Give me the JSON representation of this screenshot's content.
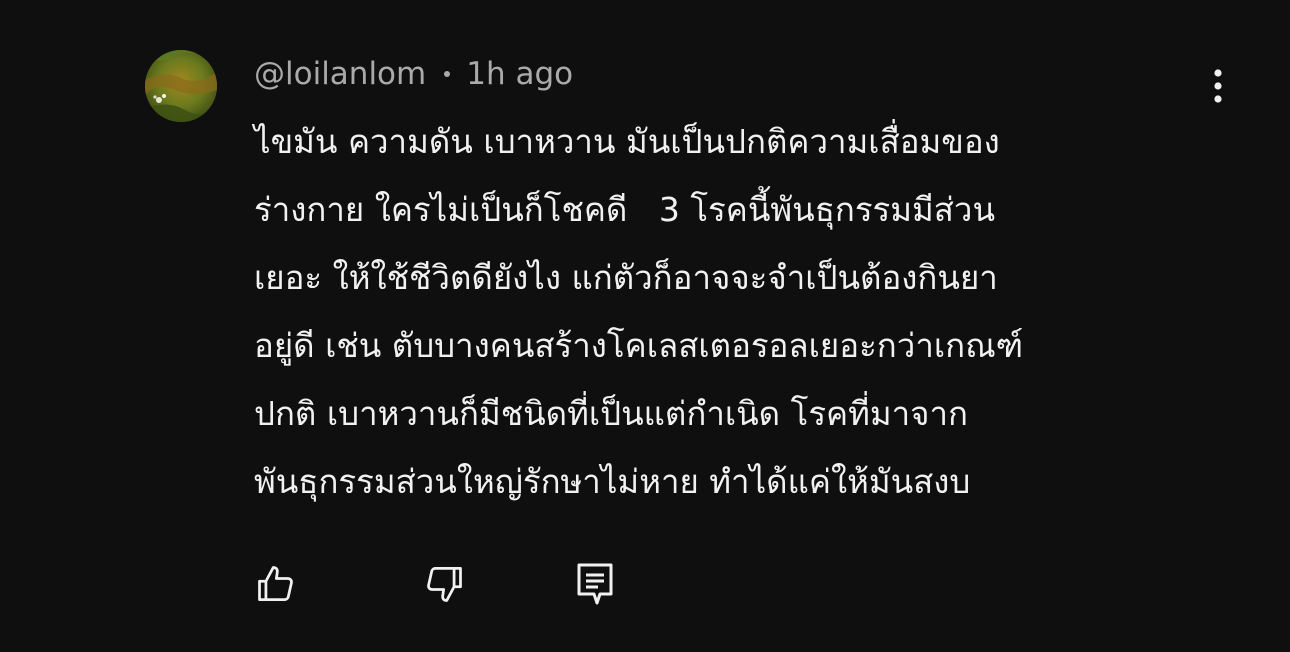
{
  "comment": {
    "author": "@loilanlom",
    "timestamp": "1h ago",
    "lines": [
      "ไขมัน ความดัน เบาหวาน มันเป็นปกติความเสื่อมของ",
      "ร่างกาย ใครไม่เป็นก็โชคดี   3 โรคนี้พันธุกรรมมีส่วน",
      "เยอะ ให้ใช้ชีวิตดียังไง แก่ตัวก็อาจจะจำเป็นต้องกินยา",
      "อยู่ดี เช่น ตับบางคนสร้างโคเลสเตอรอลเยอะกว่าเกณฑ์",
      "ปกติ เบาหวานก็มีชนิดที่เป็นแต่กำเนิด โรคที่มาจาก",
      "พันธุกรรมส่วนใหญ่รักษาไม่หาย ทำได้แค่ให้มันสงบ"
    ]
  },
  "icons": {
    "menu": "more-vertical-icon",
    "like": "thumbs-up-icon",
    "dislike": "thumbs-down-icon",
    "reply": "comment-reply-icon"
  },
  "colors": {
    "background": "#0f0f0f",
    "text_primary": "#f1f1f1",
    "text_secondary": "#aaaaaa"
  }
}
